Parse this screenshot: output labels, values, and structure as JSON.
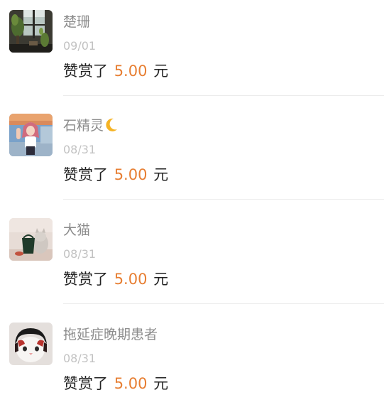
{
  "reward_list": [
    {
      "name": "楚珊",
      "has_moon": false,
      "date": "09/01",
      "reward_prefix": "赞赏了",
      "amount": "5.00",
      "currency": "元",
      "avatar": "avatar-window-plants"
    },
    {
      "name": "石精灵",
      "has_moon": true,
      "date": "08/31",
      "reward_prefix": "赞赏了",
      "amount": "5.00",
      "currency": "元",
      "avatar": "avatar-girl-selfie"
    },
    {
      "name": "大猫",
      "has_moon": false,
      "date": "08/31",
      "reward_prefix": "赞赏了",
      "amount": "5.00",
      "currency": "元",
      "avatar": "avatar-cat-with-bag"
    },
    {
      "name": "拖延症晚期患者",
      "has_moon": false,
      "date": "08/31",
      "reward_prefix": "赞赏了",
      "amount": "5.00",
      "currency": "元",
      "avatar": "avatar-white-cat-wig"
    }
  ],
  "colors": {
    "name": "#8c8c8c",
    "date": "#c2c2c2",
    "text": "#222222",
    "amount": "#e77e32",
    "divider": "#ececec",
    "moon": "#f5b324"
  }
}
